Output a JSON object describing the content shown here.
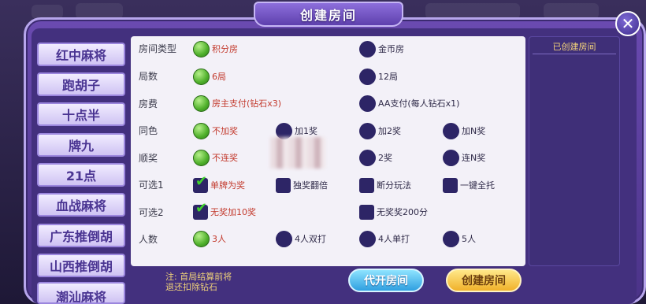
{
  "title": "创建房间",
  "close_symbol": "✕",
  "game_list": [
    "红中麻将",
    "跑胡子",
    "十点半",
    "牌九",
    "21点",
    "血战麻将",
    "广东推倒胡",
    "山西推倒胡",
    "潮汕麻将"
  ],
  "rows": [
    {
      "label": "房间类型",
      "options": [
        {
          "text": "积分房",
          "selected": true
        },
        {
          "text": "金币房",
          "selected": false
        }
      ]
    },
    {
      "label": "局数",
      "options": [
        {
          "text": "6局",
          "selected": true
        },
        {
          "text": "12局",
          "selected": false
        }
      ]
    },
    {
      "label": "房费",
      "options": [
        {
          "text": "房主支付(钻石x3)",
          "selected": true
        },
        {
          "text": "AA支付(每人钻石x1)",
          "selected": false
        }
      ]
    },
    {
      "label": "同色",
      "options": [
        {
          "text": "不加奖",
          "selected": true
        },
        {
          "text": "加1奖",
          "selected": false
        },
        {
          "text": "加2奖",
          "selected": false
        },
        {
          "text": "加N奖",
          "selected": false
        }
      ]
    },
    {
      "label": "顺奖",
      "options": [
        {
          "text": "不连奖",
          "selected": true
        },
        {
          "text": "2奖",
          "selected": false
        },
        {
          "text": "连N奖",
          "selected": false
        }
      ]
    },
    {
      "label": "可选1",
      "options": [
        {
          "text": "单牌为奖",
          "selected": true
        },
        {
          "text": "独奖翻倍",
          "selected": false
        },
        {
          "text": "断分玩法",
          "selected": false
        },
        {
          "text": "一键全托",
          "selected": false
        }
      ]
    },
    {
      "label": "可选2",
      "options": [
        {
          "text": "无奖加10奖",
          "selected": true
        },
        {
          "text": "无奖奖200分",
          "selected": false
        }
      ]
    },
    {
      "label": "人数",
      "options": [
        {
          "text": "3人",
          "selected": true
        },
        {
          "text": "4人双打",
          "selected": false
        },
        {
          "text": "4人单打",
          "selected": false
        },
        {
          "text": "5人",
          "selected": false
        }
      ]
    }
  ],
  "created_rooms_title": "已创建房间",
  "note_line1": "注: 首局结算前将",
  "note_line2": "退还扣除钻石",
  "proxy_button": "代开房间",
  "create_button": "创建房间",
  "colors": {
    "accent_purple": "#6a4ab0",
    "selected_green": "#4fb02b",
    "selected_text_red": "#c33a2d",
    "note_gold": "#f0d27a"
  }
}
